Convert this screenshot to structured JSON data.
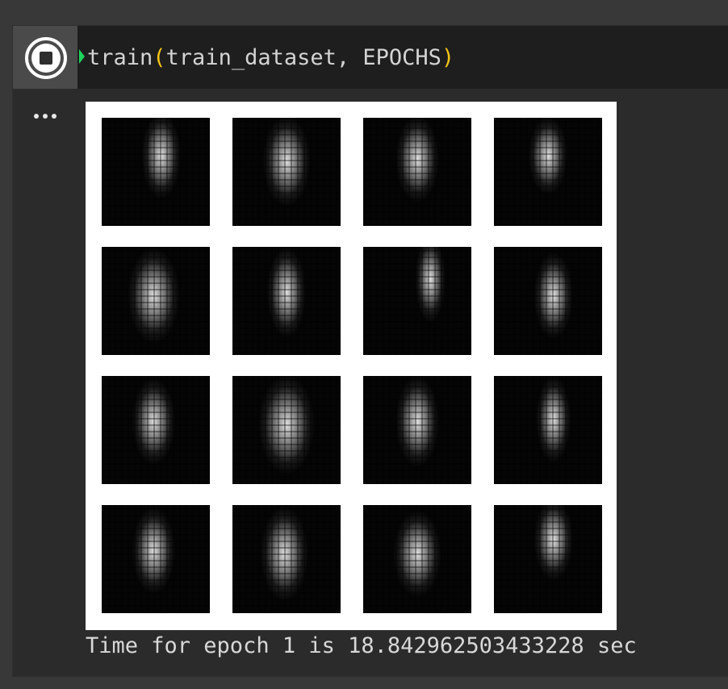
{
  "cell": {
    "code": {
      "fn": "train",
      "open_paren": "(",
      "args": "train_dataset, EPOCHS",
      "close_paren": ")"
    },
    "run_button_icon": "stop-circle-icon",
    "more_icon": "more-horizontal-icon"
  },
  "output": {
    "figure": {
      "rows": 4,
      "cols": 4,
      "description_count": 16
    },
    "text": "Time for epoch 1 is 18.842962503433228 sec"
  },
  "colors": {
    "background": "#383838",
    "code_bg": "#1e1e1e",
    "output_bg": "#2b2b2b",
    "paren": "#f5c518",
    "caret": "#1fd35c"
  }
}
